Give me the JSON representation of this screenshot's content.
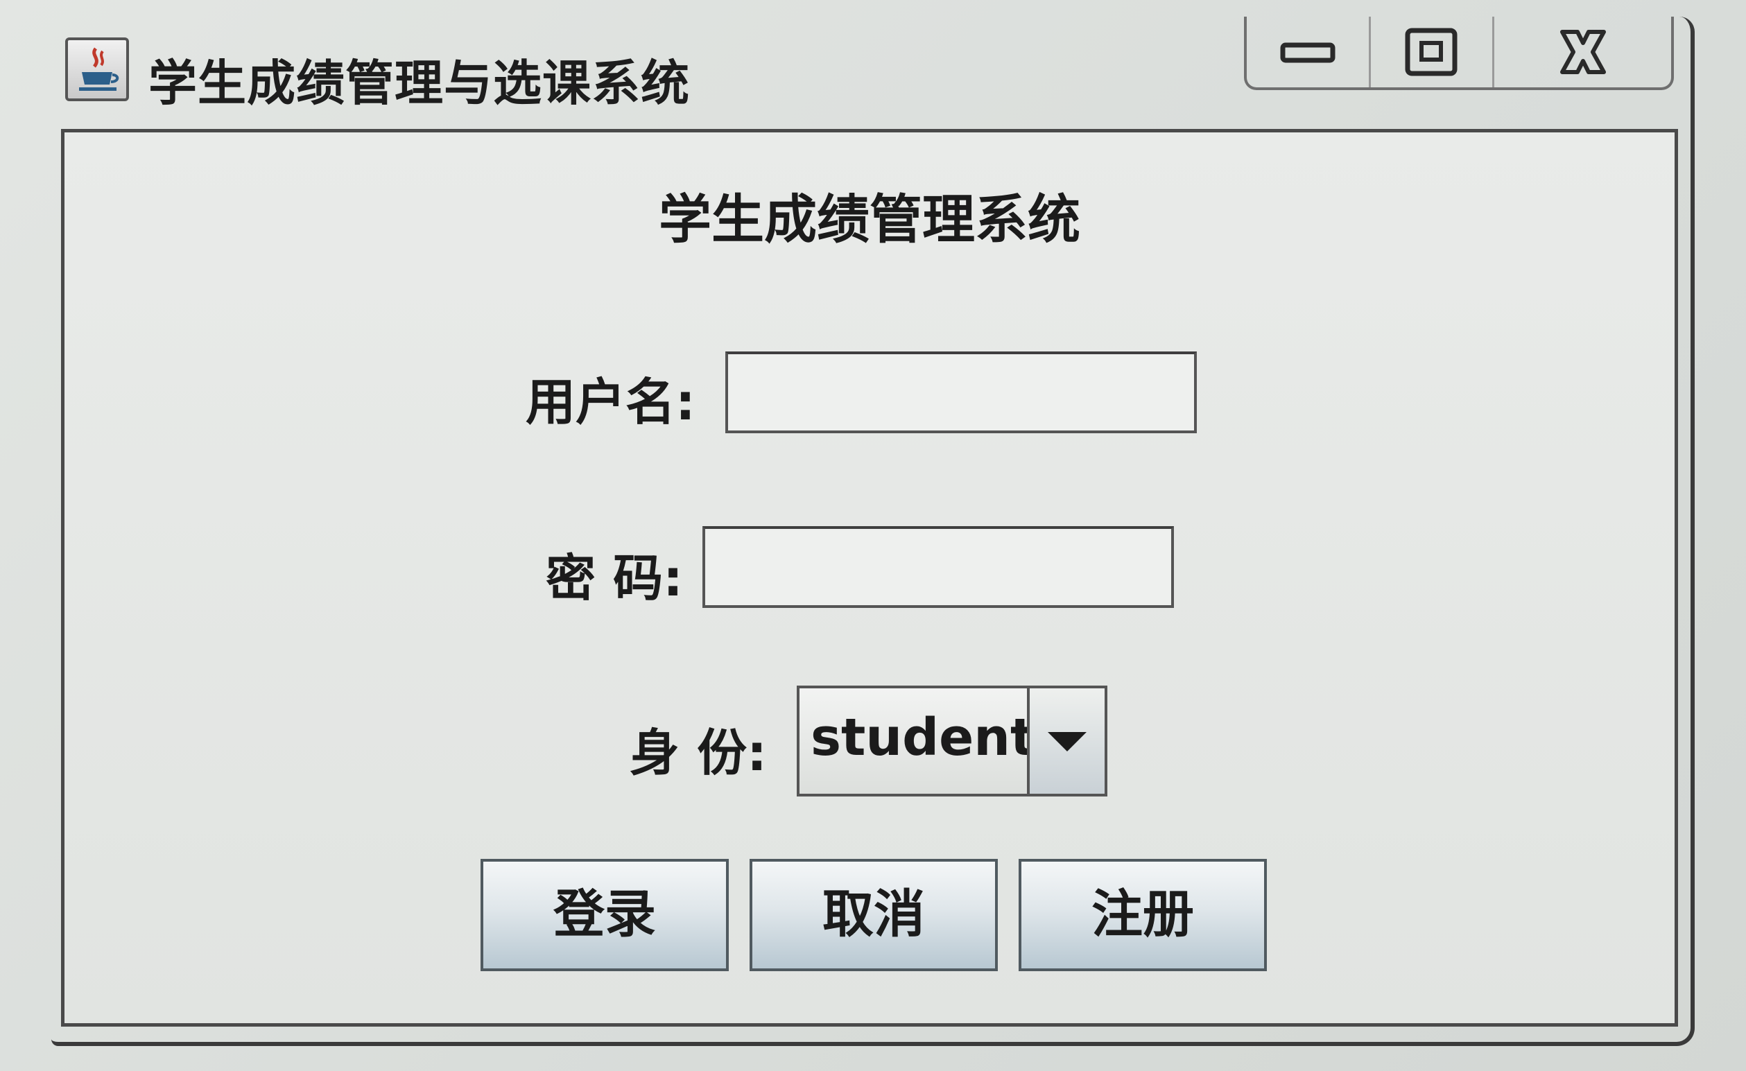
{
  "window": {
    "title": "学生成绩管理与选课系统",
    "app_icon": "java-coffee-icon",
    "controls": {
      "minimize_icon": "minimize-icon",
      "maximize_icon": "maximize-icon",
      "close_icon": "close-icon"
    }
  },
  "form": {
    "heading": "学生成绩管理系统",
    "username_label": "用户名:",
    "username_value": "",
    "password_label": "密 码:",
    "password_value": "",
    "role_label": "身 份:",
    "role_selected": "student"
  },
  "buttons": {
    "login": "登录",
    "cancel": "取消",
    "register": "注册"
  }
}
